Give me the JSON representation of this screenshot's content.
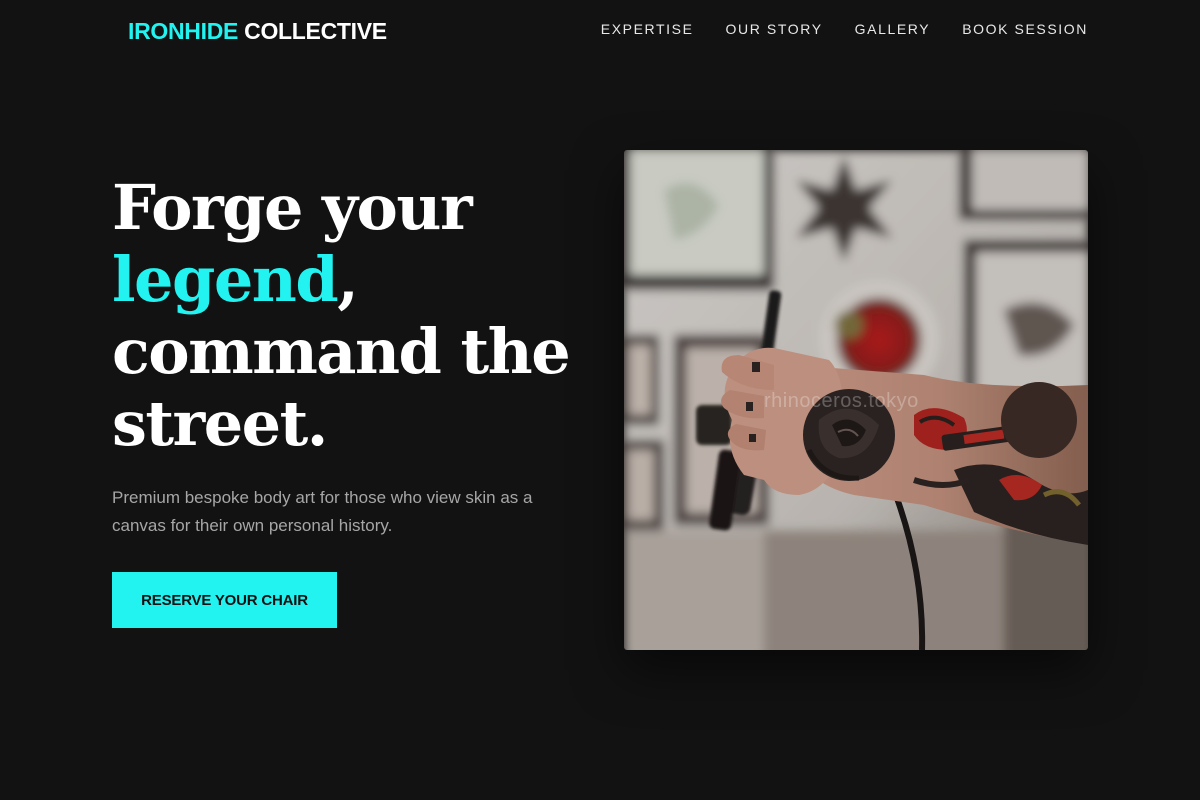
{
  "header": {
    "logo_accent": "IRONHIDE",
    "logo_rest": "COLLECTIVE",
    "nav": [
      "EXPERTISE",
      "OUR STORY",
      "GALLERY",
      "BOOK SESSION"
    ]
  },
  "hero": {
    "title_line1": "Forge your",
    "title_accent": "legend",
    "title_comma": ",",
    "title_line3": "command the",
    "title_line4": "street.",
    "subtitle": "Premium bespoke body art for those who view skin as a canvas for their own personal history.",
    "cta_label": "RESERVE YOUR CHAIR"
  },
  "image": {
    "watermark": "rhinoceros.tokyo"
  },
  "colors": {
    "background": "#121212",
    "accent": "#22f3f0",
    "text": "#ffffff",
    "muted_text": "#a6a6a6"
  }
}
